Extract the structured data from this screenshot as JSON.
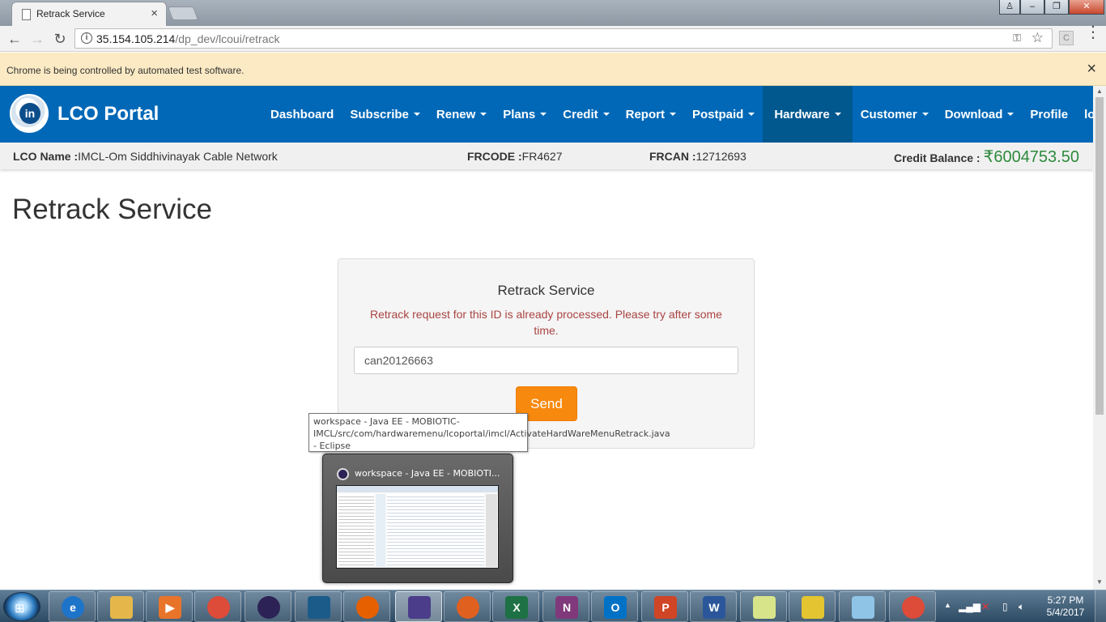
{
  "browser": {
    "tab_title": "Retrack Service",
    "url_host": "35.154.105.214",
    "url_path": "/dp_dev/lcoui/retrack",
    "infobar_message": "Chrome is being controlled by automated test software.",
    "ext_label": "C"
  },
  "site": {
    "brand": "LCO Portal",
    "logo_text": "in",
    "nav": [
      {
        "label": "Dashboard",
        "dropdown": false
      },
      {
        "label": "Subscribe",
        "dropdown": true
      },
      {
        "label": "Renew",
        "dropdown": true
      },
      {
        "label": "Plans",
        "dropdown": true
      },
      {
        "label": "Credit",
        "dropdown": true
      },
      {
        "label": "Report",
        "dropdown": true
      },
      {
        "label": "Postpaid",
        "dropdown": true
      },
      {
        "label": "Hardware",
        "dropdown": true,
        "active": true
      },
      {
        "label": "Customer",
        "dropdown": true
      },
      {
        "label": "Download",
        "dropdown": true
      },
      {
        "label": "Profile",
        "dropdown": false
      },
      {
        "label": "logout",
        "dropdown": false
      }
    ]
  },
  "info": {
    "lco_label": "LCO Name :",
    "lco_value": "IMCL-Om Siddhivinayak Cable Network",
    "frcode_label": "FRCODE :",
    "frcode_value": "FR4627",
    "frcan_label": "FRCAN :",
    "frcan_value": "12712693",
    "credit_label": "Credit Balance :",
    "credit_value": "₹6004753.50"
  },
  "page": {
    "title": "Retrack Service",
    "card_title": "Retrack Service",
    "error_message": "Retrack request for this ID is already processed. Please try after some time.",
    "input_value": "can20126663",
    "send_label": "Send"
  },
  "taskbar_popup": {
    "tooltip": "workspace - Java EE - MOBIOTIC-IMCL/src/com/hardwaremenu/lcoportal/imcl/ActivateHardWareMenuRetrack.java - Eclipse",
    "preview_title": "workspace - Java EE - MOBIOTI..."
  },
  "taskbar": {
    "items": [
      {
        "name": "internet-explorer",
        "glyph": "e",
        "color": "#1e74c9"
      },
      {
        "name": "file-explorer",
        "glyph": "",
        "color": "#e5b74b"
      },
      {
        "name": "media-player",
        "glyph": "▶",
        "color": "#e8742a"
      },
      {
        "name": "chrome",
        "glyph": "",
        "color": "#dd4b39"
      },
      {
        "name": "eclipse",
        "glyph": "",
        "color": "#2c2255"
      },
      {
        "name": "mysql-workbench",
        "glyph": "",
        "color": "#1a5b8a"
      },
      {
        "name": "firefox",
        "glyph": "",
        "color": "#e66000"
      },
      {
        "name": "java-ee-ide",
        "glyph": "",
        "color": "#4b3d8a"
      },
      {
        "name": "tool",
        "glyph": "",
        "color": "#e0601f"
      },
      {
        "name": "excel",
        "glyph": "X",
        "color": "#1d7144"
      },
      {
        "name": "onenote",
        "glyph": "N",
        "color": "#80397b"
      },
      {
        "name": "outlook",
        "glyph": "O",
        "color": "#0072c6"
      },
      {
        "name": "powerpoint",
        "glyph": "P",
        "color": "#d04525"
      },
      {
        "name": "word",
        "glyph": "W",
        "color": "#2b579a"
      },
      {
        "name": "notes",
        "glyph": "",
        "color": "#d8e48a"
      },
      {
        "name": "archive",
        "glyph": "",
        "color": "#e4c430"
      },
      {
        "name": "editor",
        "glyph": "",
        "color": "#8fc4e6"
      },
      {
        "name": "chrome-active",
        "glyph": "",
        "color": "#dd4b39"
      }
    ],
    "time": "5:27 PM",
    "date": "5/4/2017"
  }
}
